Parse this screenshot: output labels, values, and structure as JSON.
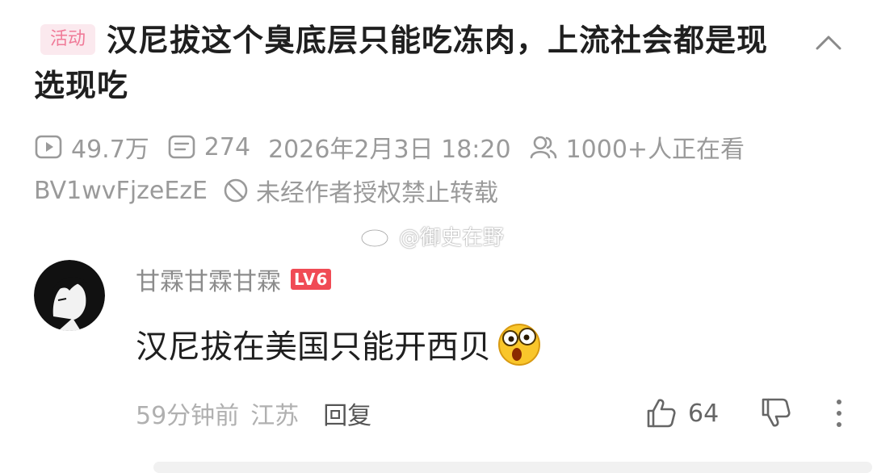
{
  "post": {
    "tag": "活动",
    "title": "汉尼拔这个臭底层只能吃冻肉，上流社会都是现选现吃",
    "views": "49.7万",
    "danmaku": "274",
    "datetime": "2026年2月3日 18:20",
    "watching": "1000+人正在看",
    "bvid": "BV1wvFjzeEzE",
    "copyright_notice": "未经作者授权禁止转载"
  },
  "watermark": {
    "text": "@御史在野"
  },
  "comment": {
    "username": "甘霖甘霖甘霖",
    "level": "LV6",
    "text": "汉尼拔在美国只能开西贝",
    "emoji": "astonished-face-icon",
    "time": "59分钟前",
    "location": "江苏",
    "reply_label": "回复",
    "likes": "64"
  },
  "colors": {
    "tag_bg": "#fbe9ee",
    "tag_text": "#f07a98",
    "level_badge": "#f04b55",
    "meta_text": "#9a9a9a"
  }
}
